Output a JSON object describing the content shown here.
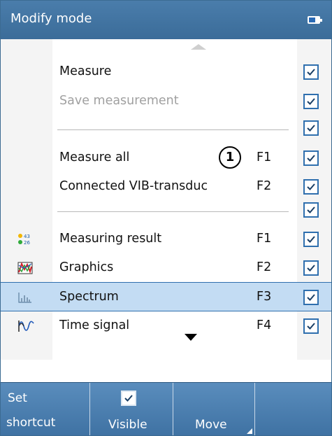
{
  "window": {
    "title": "Modify mode",
    "battery_icon": "battery-icon"
  },
  "list": {
    "rows": [
      {
        "type": "item",
        "label": "Measure",
        "shortcut": "",
        "checked": true,
        "enabled": true,
        "icon": ""
      },
      {
        "type": "item",
        "label": "Save measurement",
        "shortcut": "",
        "checked": true,
        "enabled": false,
        "icon": ""
      },
      {
        "type": "separator",
        "checked": true
      },
      {
        "type": "item",
        "label": "Measure all",
        "shortcut": "F1",
        "checked": true,
        "enabled": true,
        "icon": ""
      },
      {
        "type": "item",
        "label": "Connected VIB-transduc",
        "shortcut": "F2",
        "checked": true,
        "enabled": true,
        "icon": ""
      },
      {
        "type": "separator",
        "checked": true
      },
      {
        "type": "item",
        "label": "Measuring result",
        "shortcut": "F1",
        "checked": true,
        "enabled": true,
        "icon": "measuring-result-icon"
      },
      {
        "type": "item",
        "label": "Graphics",
        "shortcut": "F2",
        "checked": true,
        "enabled": true,
        "icon": "graphics-icon"
      },
      {
        "type": "item",
        "label": "Spectrum",
        "shortcut": "F3",
        "checked": true,
        "enabled": true,
        "icon": "spectrum-icon",
        "selected": true
      },
      {
        "type": "item",
        "label": "Time signal",
        "shortcut": "F4",
        "checked": true,
        "enabled": true,
        "icon": "time-signal-icon"
      }
    ],
    "scroll_up_icon": "scroll-up-icon",
    "scroll_down_icon": "scroll-down-icon"
  },
  "callout": {
    "number": "1"
  },
  "softkeys": {
    "set_shortcut_line1": "Set",
    "set_shortcut_line2": "shortcut",
    "visible_label": "Visible",
    "visible_checked": true,
    "move_label": "Move"
  },
  "colors": {
    "titlebar": "#3b6c99",
    "selected_row": "#c3dcf3",
    "checkbox_border": "#2f6fae",
    "disabled_text": "#a0a0a0"
  }
}
